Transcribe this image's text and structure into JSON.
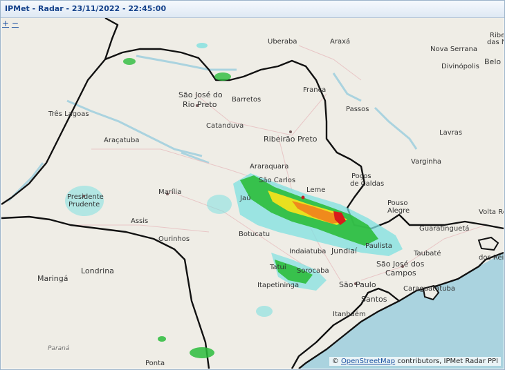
{
  "window": {
    "title": "IPMet - Radar - 23/11/2022 - 22:45:00"
  },
  "zoom": {
    "plus": "+",
    "minus": "−"
  },
  "attribution": {
    "prefix": "©",
    "link_text": "OpenStreetMap",
    "suffix": "contributors, IPMet Radar PPI"
  },
  "places": {
    "uberaba": "Uberaba",
    "araxa": "Araxá",
    "ribeirao_das_neves_1": "Ribei",
    "ribeirao_das_neves_2": "das N",
    "nova_serrana": "Nova Serrana",
    "divinopolis": "Divinópolis",
    "belo_horizonte": "Belo H",
    "sao_jose_rio_preto_1": "São José do",
    "sao_jose_rio_preto_2": "Rio Preto",
    "barretos": "Barretos",
    "franca": "Franca",
    "passos": "Passos",
    "tres_lagoas": "Três Lagoas",
    "catanduva": "Catanduva",
    "ribeirao_preto": "Ribeirão Preto",
    "lavras": "Lavras",
    "aracatuba": "Araçatuba",
    "araraquara": "Araraquara",
    "sao_carlos": "São Carlos",
    "varginha": "Varginha",
    "marilia": "Marília",
    "leme": "Leme",
    "pocos_1": "Poços",
    "pocos_2": "de Caldas",
    "presidente_prudente_1": "Presidente",
    "presidente_prudente_2": "Prudente",
    "assis": "Assis",
    "jau": "Jaú",
    "pouso_alegre_1": "Pouso",
    "pouso_alegre_2": "Alegre",
    "volta_redonda": "Volta Re",
    "guaratingueta": "Guaratinguetá",
    "ourinhos": "Ourinhos",
    "botucatu": "Botucatu",
    "indaiatuba": "Indaiatuba",
    "jundiai": "Jundiaí",
    "paulista": "Paulista",
    "taubate": "Taubaté",
    "angra": "dos Reis",
    "maringa": "Maringá",
    "londrina": "Londrina",
    "tatui": "Tatuí",
    "sorocaba": "Sorocaba",
    "sjcampos_1": "São José dos",
    "sjcampos_2": "Campos",
    "itapetininga": "Itapetininga",
    "sao_paulo": "São Paulo",
    "caraguatatuba": "Caraguatatuba",
    "santos": "Santos",
    "itanhaem": "Itanhaém",
    "parana": "Paraná",
    "ponta": "Ponta"
  },
  "colors": {
    "land": "#efede6",
    "sea": "#aad3df",
    "border": "#111111",
    "radar_light": "#7fe0e0",
    "radar_green": "#2cbc3c",
    "radar_yellow": "#f2e21c",
    "radar_orange": "#f08a1c",
    "radar_red": "#d81b1b"
  }
}
